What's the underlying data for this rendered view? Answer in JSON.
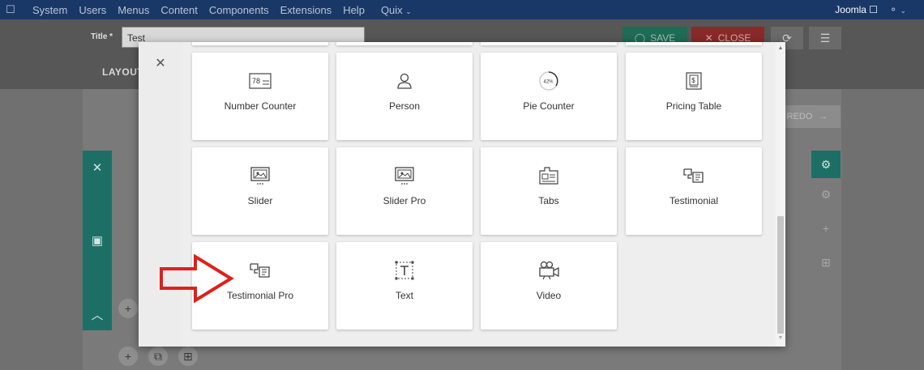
{
  "topbar": {
    "joomla_logo": "",
    "items": [
      "System",
      "Users",
      "Menus",
      "Content",
      "Components",
      "Extensions",
      "Help"
    ],
    "quix_label": "Quix",
    "site_label": "Joomla",
    "user_icon": "user-icon"
  },
  "toolbar": {
    "title_label": "Title *",
    "title_value": "Test",
    "save_label": "SAVE",
    "close_label": "CLOSE",
    "layout_tab": "LAYOUT"
  },
  "builder": {
    "redo_label": "REDO"
  },
  "modal": {
    "elements": [
      {
        "label": "Number Counter",
        "icon": "number-counter-icon"
      },
      {
        "label": "Person",
        "icon": "person-icon"
      },
      {
        "label": "Pie Counter",
        "icon": "pie-counter-icon",
        "icon_text": "42%"
      },
      {
        "label": "Pricing Table",
        "icon": "pricing-table-icon"
      },
      {
        "label": "Slider",
        "icon": "slider-icon"
      },
      {
        "label": "Slider Pro",
        "icon": "slider-pro-icon"
      },
      {
        "label": "Tabs",
        "icon": "tabs-icon"
      },
      {
        "label": "Testimonial",
        "icon": "testimonial-icon"
      },
      {
        "label": "Testimonial Pro",
        "icon": "testimonial-pro-icon"
      },
      {
        "label": "Text",
        "icon": "text-icon"
      },
      {
        "label": "Video",
        "icon": "video-icon"
      }
    ],
    "number_counter_icon_text": "78"
  },
  "colors": {
    "topbar": "#1a3867",
    "accent_teal": "#1d6f65",
    "save_green": "#1e6b56",
    "close_red": "#8a2929",
    "arrow_red": "#e0201c"
  }
}
